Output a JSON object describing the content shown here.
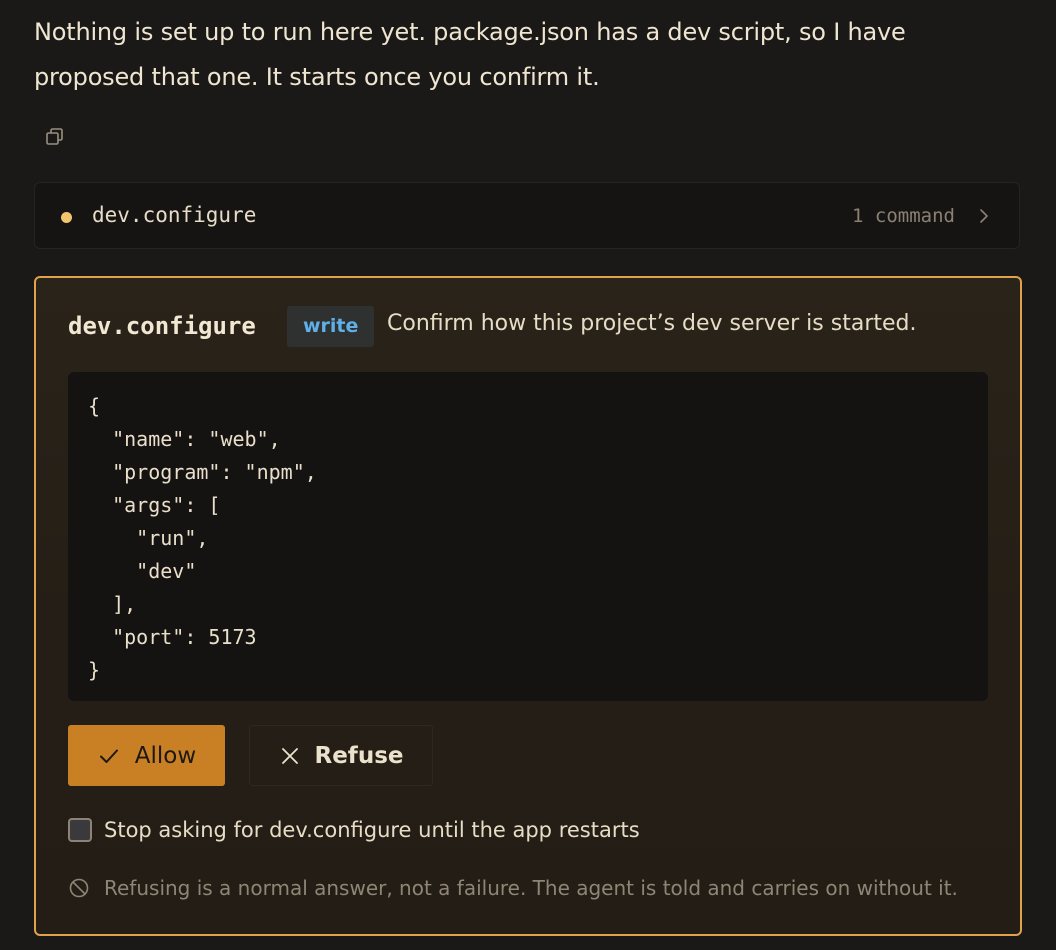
{
  "message": {
    "line1": "Nothing is set up to run here yet. package.json has a dev script, so I have",
    "line2": "proposed that one. It starts once you confirm it."
  },
  "copy_icon": "copy-icon",
  "tool_row": {
    "name": "dev.configure",
    "count": "1 command",
    "status_color": "#f2c46b"
  },
  "approval": {
    "tool_name": "dev.configure",
    "badge": "write",
    "description": "Confirm how this project’s dev server is started.",
    "code": "{\n  \"name\": \"web\",\n  \"program\": \"npm\",\n  \"args\": [\n    \"run\",\n    \"dev\"\n  ],\n  \"port\": 5173\n}",
    "allow_label": "Allow",
    "refuse_label": "Refuse",
    "checkbox_label": "Stop asking for dev.configure until the app restarts",
    "checkbox_checked": false,
    "note": "Refusing is a normal answer, not a failure. The agent is told and carries on without it.",
    "accent_color": "#e0a24a",
    "allow_color": "#c98024",
    "badge_color": "#5fb0e8"
  }
}
